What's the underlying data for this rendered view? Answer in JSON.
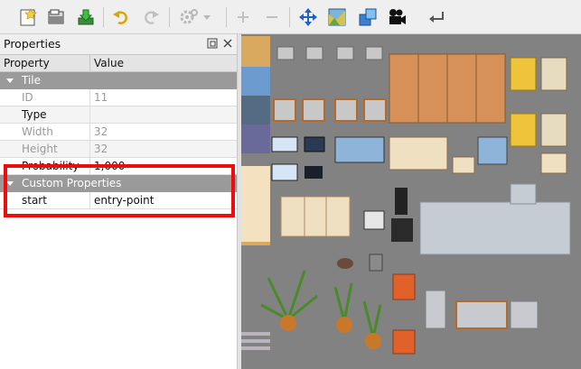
{
  "toolbar": {
    "buttons": [
      {
        "name": "new-tileset-icon",
        "enabled": true
      },
      {
        "name": "open-file-icon",
        "enabled": true
      },
      {
        "name": "export-icon",
        "enabled": true
      },
      {
        "name": "undo-icon",
        "enabled": true
      },
      {
        "name": "redo-icon",
        "enabled": false
      },
      {
        "name": "settings-gear-icon",
        "enabled": false
      },
      {
        "name": "add-icon",
        "enabled": false
      },
      {
        "name": "remove-icon",
        "enabled": false
      },
      {
        "name": "move-arrows-icon",
        "enabled": true
      },
      {
        "name": "terrain-icon",
        "enabled": true
      },
      {
        "name": "shapes-icon",
        "enabled": true
      },
      {
        "name": "movie-camera-icon",
        "enabled": true
      },
      {
        "name": "return-arrow-icon",
        "enabled": true
      }
    ]
  },
  "properties_panel": {
    "title": "Properties",
    "header": {
      "property": "Property",
      "value": "Value"
    },
    "groups": [
      {
        "label": "Tile",
        "rows": [
          {
            "key": "ID",
            "value": "11",
            "readonly": true
          },
          {
            "key": "Type",
            "value": "",
            "readonly": false
          },
          {
            "key": "Width",
            "value": "32",
            "readonly": true
          },
          {
            "key": "Height",
            "value": "32",
            "readonly": true
          },
          {
            "key": "Probability",
            "value": "1,000",
            "readonly": false
          }
        ]
      },
      {
        "label": "Custom Properties",
        "rows": [
          {
            "key": "start",
            "value": "entry-point",
            "readonly": false
          }
        ]
      }
    ]
  },
  "colors": {
    "highlight_border": "#ee0c0c",
    "group_header": "#9a9a9a",
    "tileset_background": "#828282"
  }
}
